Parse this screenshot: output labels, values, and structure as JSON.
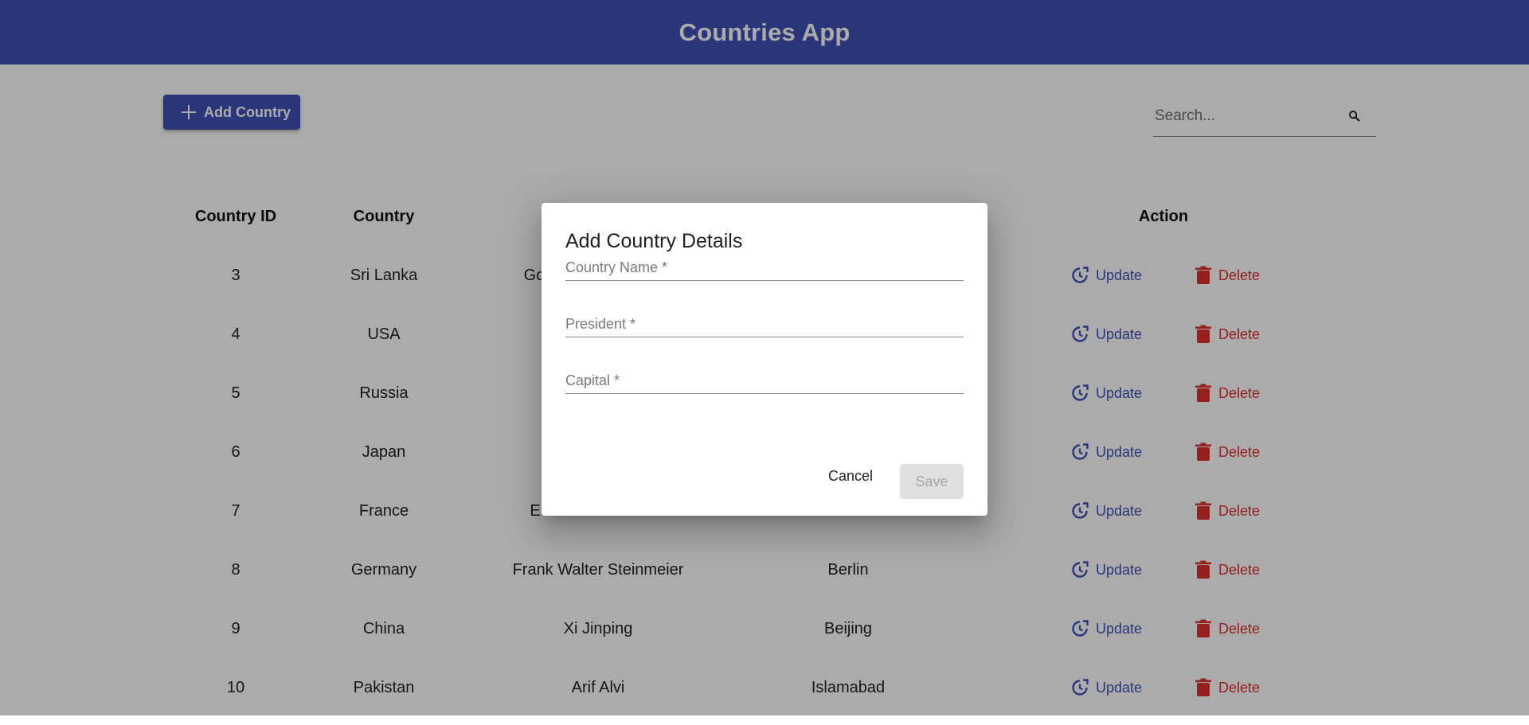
{
  "app": {
    "title": "Countries App"
  },
  "toolbar": {
    "add_label": "Add Country"
  },
  "search": {
    "placeholder": "Search..."
  },
  "table": {
    "headers": {
      "id": "Country ID",
      "country": "Country",
      "action": "Action"
    },
    "rows": [
      {
        "id": "3",
        "country": "Sri Lanka",
        "president": "Go",
        "capital": ""
      },
      {
        "id": "4",
        "country": "USA",
        "president": "",
        "capital": ""
      },
      {
        "id": "5",
        "country": "Russia",
        "president": "",
        "capital": ""
      },
      {
        "id": "6",
        "country": "Japan",
        "president": "",
        "capital": ""
      },
      {
        "id": "7",
        "country": "France",
        "president": "E",
        "capital": ""
      },
      {
        "id": "8",
        "country": "Germany",
        "president": "Frank Walter Steinmeier",
        "capital": "Berlin"
      },
      {
        "id": "9",
        "country": "China",
        "president": "Xi Jinping",
        "capital": "Beijing"
      },
      {
        "id": "10",
        "country": "Pakistan",
        "president": "Arif Alvi",
        "capital": "Islamabad"
      }
    ],
    "update_label": "Update",
    "delete_label": "Delete"
  },
  "dialog": {
    "title": "Add Country Details",
    "fields": {
      "country_name": "Country Name *",
      "president": "President *",
      "capital": "Capital *"
    },
    "cancel_label": "Cancel",
    "save_label": "Save"
  },
  "colors": {
    "primary": "#3f51b5",
    "danger": "#e0302a",
    "disabled_bg": "#e0e0e0"
  },
  "icons": {
    "add": "plus-icon",
    "search": "search-icon",
    "update": "update-icon",
    "delete": "trash-icon"
  }
}
